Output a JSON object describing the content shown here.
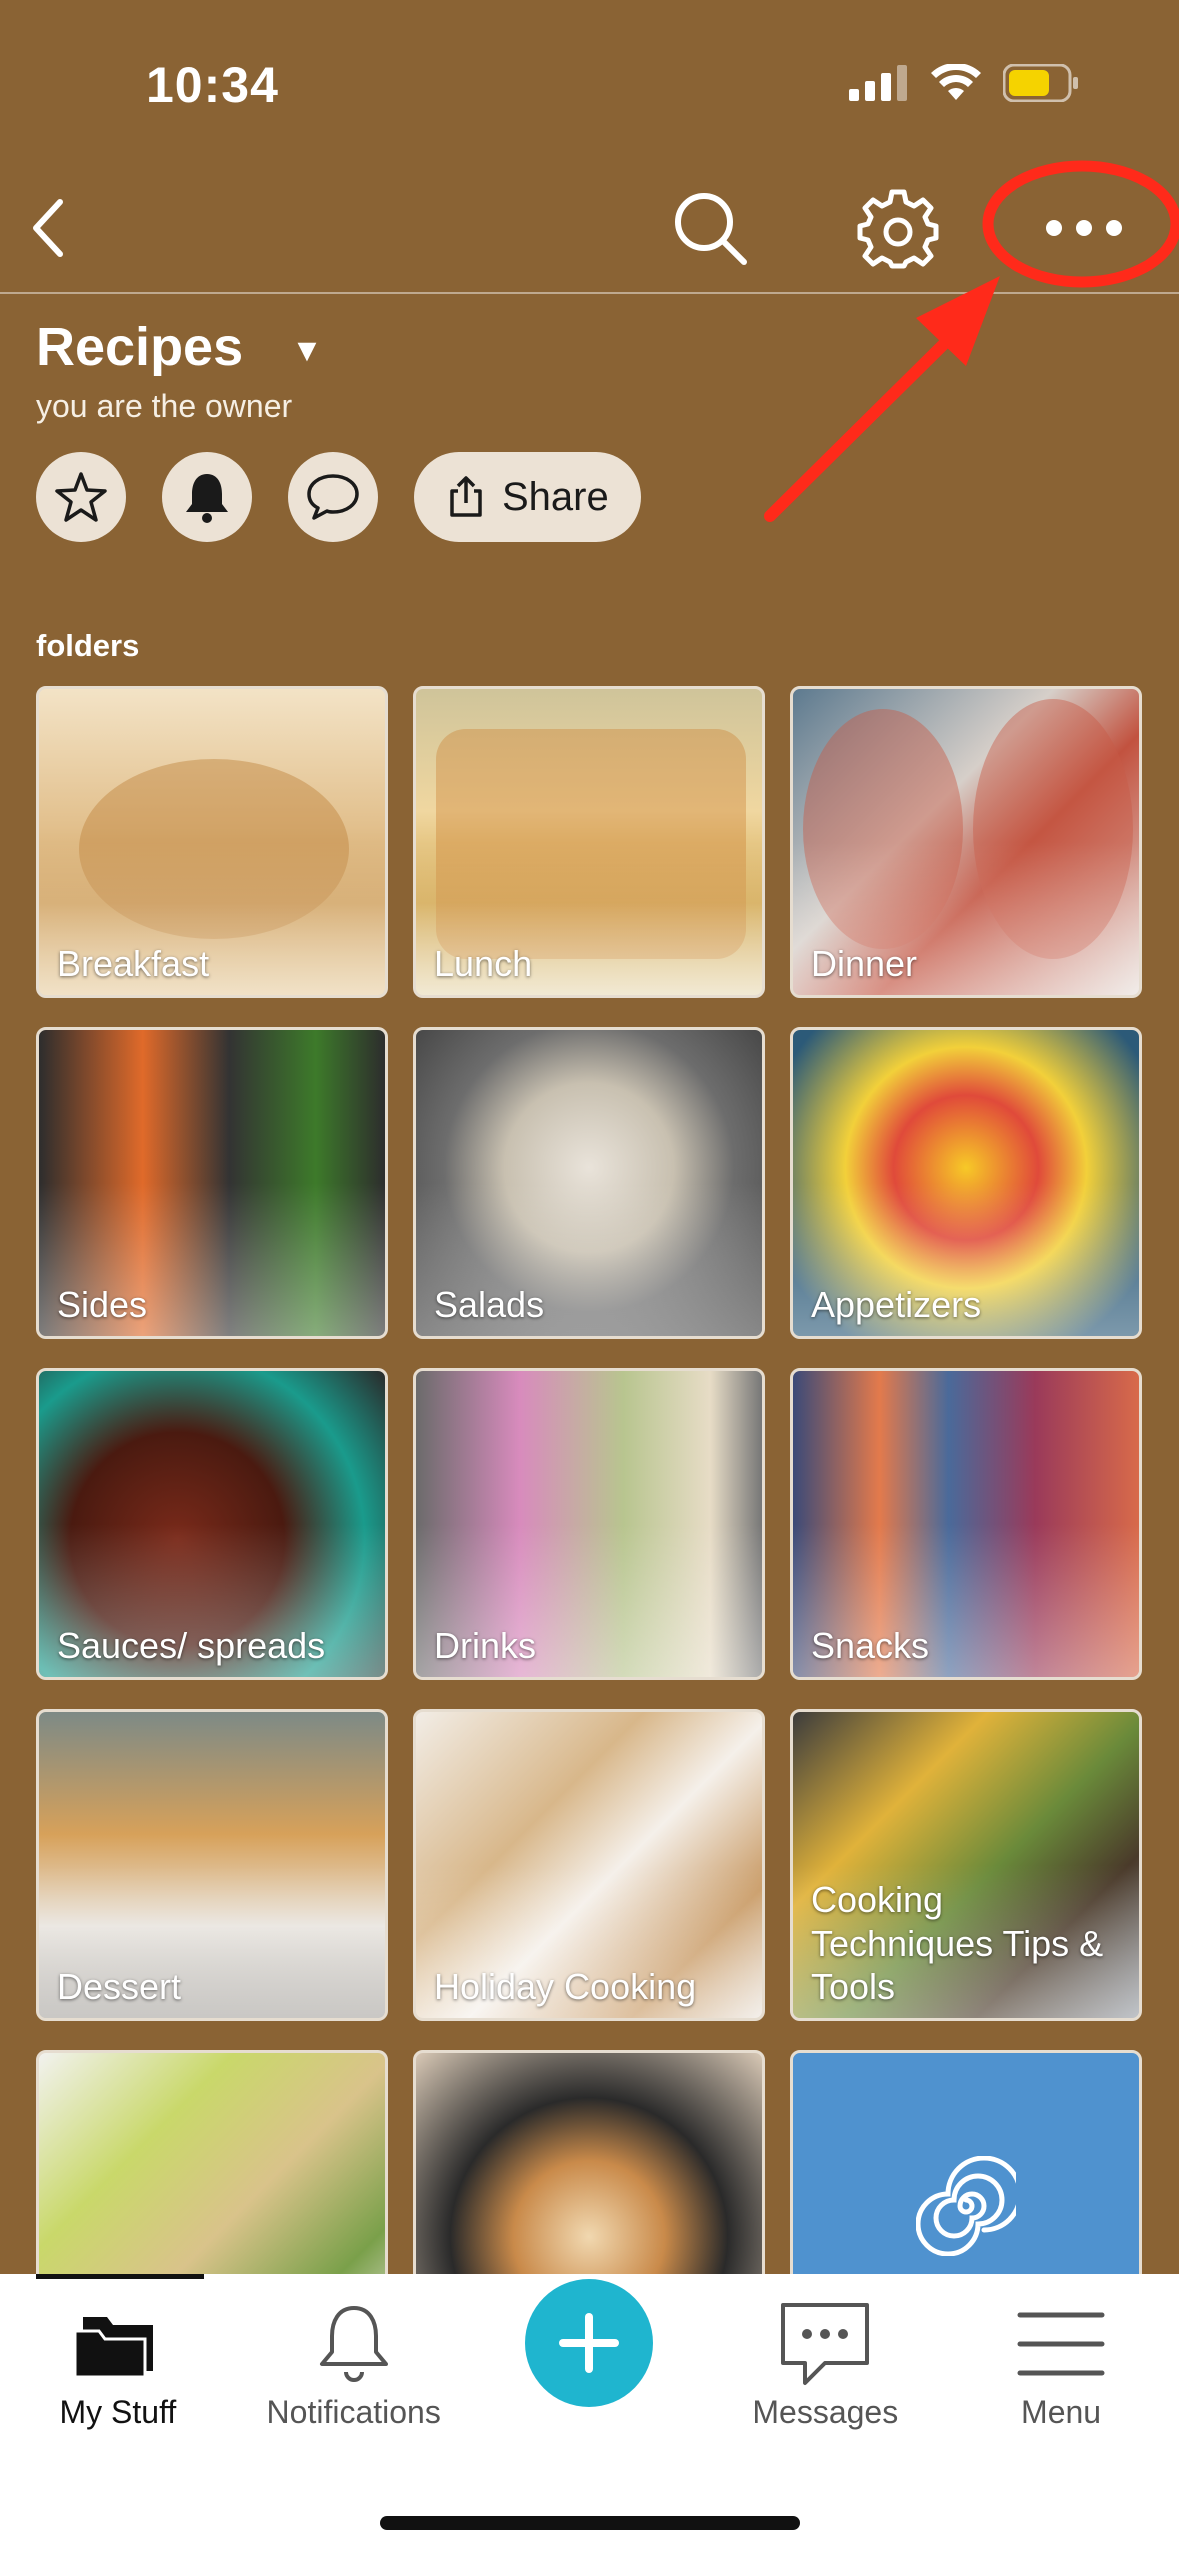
{
  "status_bar": {
    "time": "10:34"
  },
  "header": {
    "title": "Recipes",
    "caret": "▼",
    "subtitle": "you are the owner",
    "share_label": "Share"
  },
  "folders": {
    "label": "folders",
    "items": [
      {
        "label": "Breakfast"
      },
      {
        "label": "Lunch"
      },
      {
        "label": "Dinner"
      },
      {
        "label": "Sides"
      },
      {
        "label": "Salads"
      },
      {
        "label": "Appetizers"
      },
      {
        "label": "Sauces/ spreads"
      },
      {
        "label": "Drinks"
      },
      {
        "label": "Snacks"
      },
      {
        "label": "Dessert"
      },
      {
        "label": "Holiday Cooking"
      },
      {
        "label": "Cooking Techniques Tips & Tools"
      },
      {
        "label": ""
      },
      {
        "label": ""
      },
      {
        "label": ""
      }
    ]
  },
  "tabs": {
    "my_stuff": "My Stuff",
    "notifications": "Notifications",
    "messages": "Messages",
    "menu": "Menu"
  },
  "colors": {
    "background": "#8a6334",
    "fab": "#1fb5cf",
    "annotation": "#ff2a1a"
  },
  "icons": [
    "back-icon",
    "search-icon",
    "gear-icon",
    "more-icon",
    "star-icon",
    "bell-icon",
    "chat-icon",
    "share-icon",
    "folder-icon",
    "spiral-icon",
    "plus-icon",
    "menu-icon"
  ]
}
